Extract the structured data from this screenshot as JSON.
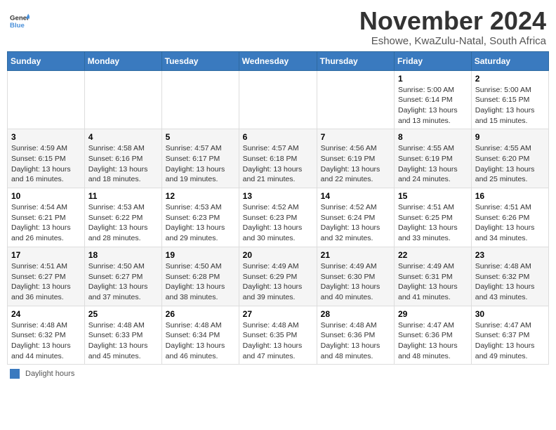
{
  "logo": {
    "line1": "General",
    "line2": "Blue"
  },
  "title": "November 2024",
  "subtitle": "Eshowe, KwaZulu-Natal, South Africa",
  "days_of_week": [
    "Sunday",
    "Monday",
    "Tuesday",
    "Wednesday",
    "Thursday",
    "Friday",
    "Saturday"
  ],
  "legend_label": "Daylight hours",
  "weeks": [
    [
      {
        "day": "",
        "info": ""
      },
      {
        "day": "",
        "info": ""
      },
      {
        "day": "",
        "info": ""
      },
      {
        "day": "",
        "info": ""
      },
      {
        "day": "",
        "info": ""
      },
      {
        "day": "1",
        "info": "Sunrise: 5:00 AM\nSunset: 6:14 PM\nDaylight: 13 hours\nand 13 minutes."
      },
      {
        "day": "2",
        "info": "Sunrise: 5:00 AM\nSunset: 6:15 PM\nDaylight: 13 hours\nand 15 minutes."
      }
    ],
    [
      {
        "day": "3",
        "info": "Sunrise: 4:59 AM\nSunset: 6:15 PM\nDaylight: 13 hours\nand 16 minutes."
      },
      {
        "day": "4",
        "info": "Sunrise: 4:58 AM\nSunset: 6:16 PM\nDaylight: 13 hours\nand 18 minutes."
      },
      {
        "day": "5",
        "info": "Sunrise: 4:57 AM\nSunset: 6:17 PM\nDaylight: 13 hours\nand 19 minutes."
      },
      {
        "day": "6",
        "info": "Sunrise: 4:57 AM\nSunset: 6:18 PM\nDaylight: 13 hours\nand 21 minutes."
      },
      {
        "day": "7",
        "info": "Sunrise: 4:56 AM\nSunset: 6:19 PM\nDaylight: 13 hours\nand 22 minutes."
      },
      {
        "day": "8",
        "info": "Sunrise: 4:55 AM\nSunset: 6:19 PM\nDaylight: 13 hours\nand 24 minutes."
      },
      {
        "day": "9",
        "info": "Sunrise: 4:55 AM\nSunset: 6:20 PM\nDaylight: 13 hours\nand 25 minutes."
      }
    ],
    [
      {
        "day": "10",
        "info": "Sunrise: 4:54 AM\nSunset: 6:21 PM\nDaylight: 13 hours\nand 26 minutes."
      },
      {
        "day": "11",
        "info": "Sunrise: 4:53 AM\nSunset: 6:22 PM\nDaylight: 13 hours\nand 28 minutes."
      },
      {
        "day": "12",
        "info": "Sunrise: 4:53 AM\nSunset: 6:23 PM\nDaylight: 13 hours\nand 29 minutes."
      },
      {
        "day": "13",
        "info": "Sunrise: 4:52 AM\nSunset: 6:23 PM\nDaylight: 13 hours\nand 30 minutes."
      },
      {
        "day": "14",
        "info": "Sunrise: 4:52 AM\nSunset: 6:24 PM\nDaylight: 13 hours\nand 32 minutes."
      },
      {
        "day": "15",
        "info": "Sunrise: 4:51 AM\nSunset: 6:25 PM\nDaylight: 13 hours\nand 33 minutes."
      },
      {
        "day": "16",
        "info": "Sunrise: 4:51 AM\nSunset: 6:26 PM\nDaylight: 13 hours\nand 34 minutes."
      }
    ],
    [
      {
        "day": "17",
        "info": "Sunrise: 4:51 AM\nSunset: 6:27 PM\nDaylight: 13 hours\nand 36 minutes."
      },
      {
        "day": "18",
        "info": "Sunrise: 4:50 AM\nSunset: 6:27 PM\nDaylight: 13 hours\nand 37 minutes."
      },
      {
        "day": "19",
        "info": "Sunrise: 4:50 AM\nSunset: 6:28 PM\nDaylight: 13 hours\nand 38 minutes."
      },
      {
        "day": "20",
        "info": "Sunrise: 4:49 AM\nSunset: 6:29 PM\nDaylight: 13 hours\nand 39 minutes."
      },
      {
        "day": "21",
        "info": "Sunrise: 4:49 AM\nSunset: 6:30 PM\nDaylight: 13 hours\nand 40 minutes."
      },
      {
        "day": "22",
        "info": "Sunrise: 4:49 AM\nSunset: 6:31 PM\nDaylight: 13 hours\nand 41 minutes."
      },
      {
        "day": "23",
        "info": "Sunrise: 4:48 AM\nSunset: 6:32 PM\nDaylight: 13 hours\nand 43 minutes."
      }
    ],
    [
      {
        "day": "24",
        "info": "Sunrise: 4:48 AM\nSunset: 6:32 PM\nDaylight: 13 hours\nand 44 minutes."
      },
      {
        "day": "25",
        "info": "Sunrise: 4:48 AM\nSunset: 6:33 PM\nDaylight: 13 hours\nand 45 minutes."
      },
      {
        "day": "26",
        "info": "Sunrise: 4:48 AM\nSunset: 6:34 PM\nDaylight: 13 hours\nand 46 minutes."
      },
      {
        "day": "27",
        "info": "Sunrise: 4:48 AM\nSunset: 6:35 PM\nDaylight: 13 hours\nand 47 minutes."
      },
      {
        "day": "28",
        "info": "Sunrise: 4:48 AM\nSunset: 6:36 PM\nDaylight: 13 hours\nand 48 minutes."
      },
      {
        "day": "29",
        "info": "Sunrise: 4:47 AM\nSunset: 6:36 PM\nDaylight: 13 hours\nand 48 minutes."
      },
      {
        "day": "30",
        "info": "Sunrise: 4:47 AM\nSunset: 6:37 PM\nDaylight: 13 hours\nand 49 minutes."
      }
    ]
  ]
}
